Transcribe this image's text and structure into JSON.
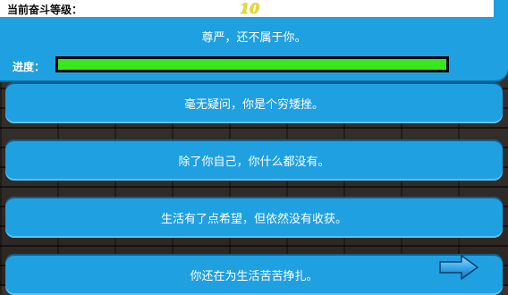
{
  "header": {
    "level_label": "当前奋斗等级：",
    "level_value": "10",
    "notice": "尊严，还不属于你。",
    "progress_label": "进度："
  },
  "progress": {
    "fraction": 1.0,
    "color": "#37e81c"
  },
  "options": [
    {
      "label": "毫无疑问，你是个穷矮挫。"
    },
    {
      "label": "除了你自己，你什么都没有。"
    },
    {
      "label": "生活有了点希望，但依然没有收获。"
    },
    {
      "label": "你还在为生活苦苦挣扎。"
    }
  ],
  "icons": {
    "next": "right-arrow-icon"
  },
  "colors": {
    "panel_blue": "#1fa0e1",
    "level_yellow": "#e8df1a",
    "progress_green": "#37e81c"
  }
}
